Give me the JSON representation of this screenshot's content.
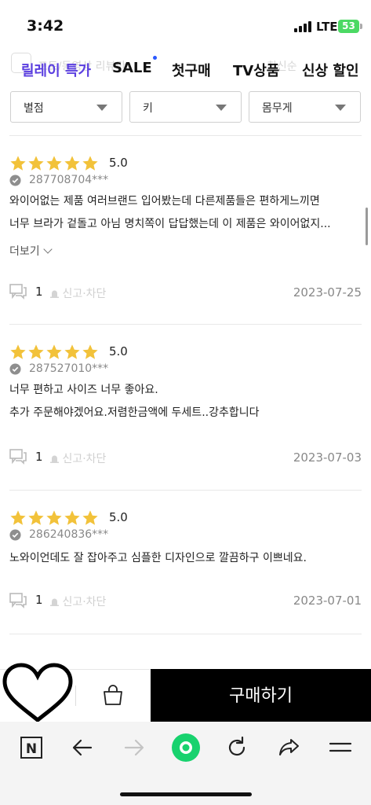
{
  "status_bar": {
    "time": "3:42",
    "network": "LTE",
    "battery": "53"
  },
  "category_nav": {
    "ghost_left": "포토/동영상 리뷰만",
    "ghost_right": "최신순",
    "items": [
      {
        "label": "릴레이 특가",
        "active": true
      },
      {
        "label": "SALE",
        "active": false
      },
      {
        "label": "첫구매",
        "active": false
      },
      {
        "label": "TV상품",
        "active": false
      },
      {
        "label": "신상 할인",
        "active": false
      }
    ]
  },
  "filters": [
    {
      "label": "별점"
    },
    {
      "label": "키"
    },
    {
      "label": "몸무게"
    }
  ],
  "reviews": [
    {
      "rating": "5.0",
      "stars": 5,
      "user_id": "287708704***",
      "lines": [
        "와이어없는 제품 여러브랜드 입어봤는데 다른제품들은 편하게느끼면",
        "너무 브라가 겉돌고 아님 명치쪽이 답답했는데 이 제품은 와이어없지..."
      ],
      "more_label": "더보기",
      "comment_count": "1",
      "report_label": "신고·차단",
      "date": "2023-07-25"
    },
    {
      "rating": "5.0",
      "stars": 5,
      "user_id": "287527010***",
      "lines": [
        "너무 편하고 사이즈 너무 좋아요.",
        "추가 주문해야겠어요.저렴한금액에 두세트..강추합니다"
      ],
      "comment_count": "1",
      "report_label": "신고·차단",
      "date": "2023-07-03"
    },
    {
      "rating": "5.0",
      "stars": 5,
      "user_id": "286240836***",
      "lines": [
        "노와이언데도 잘 잡아주고 심플한 디자인으로 깔끔하구 이쁘네요."
      ],
      "comment_count": "1",
      "report_label": "신고·차단",
      "date": "2023-07-01"
    }
  ],
  "purchase_bar": {
    "buy_label": "구매하기",
    "heart_icon": "heart-icon",
    "bag_icon": "shopping-bag-icon"
  },
  "browser_toolbar": {
    "icons": [
      "naver-n-icon",
      "back-arrow-icon",
      "forward-arrow-icon",
      "home-circle-icon",
      "refresh-icon",
      "share-icon",
      "menu-icon"
    ]
  },
  "colors": {
    "accent": "#5b3fe0",
    "star": "#f2c23a",
    "buy_button": "#000000",
    "home_green": "#18d26e"
  }
}
